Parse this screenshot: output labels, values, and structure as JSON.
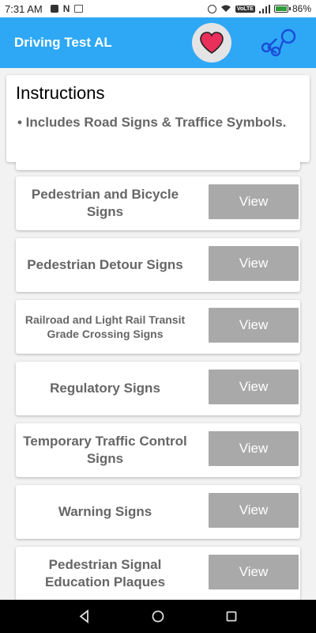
{
  "status_bar": {
    "time": "7:31 AM",
    "volte": "VoLTE",
    "battery_percent": "86%",
    "battery_level": 0.86
  },
  "app_bar": {
    "title": "Driving Test AL",
    "accent_color": "#2ea8f5",
    "favorite_icon": "heart-icon",
    "share_icon": "share-icon"
  },
  "instructions": {
    "title": "Instructions",
    "bullet": "• Includes Road Signs & Traffice Symbols."
  },
  "sign_categories": [
    {
      "label": "Pedestrian and Bicycle Signs",
      "button": "View"
    },
    {
      "label": "Pedestrian Detour Signs",
      "button": "View"
    },
    {
      "label": "Railroad and Light Rail Transit Grade Crossing Signs",
      "button": "View"
    },
    {
      "label": "Regulatory Signs",
      "button": "View"
    },
    {
      "label": "Temporary Traffic Control Signs",
      "button": "View"
    },
    {
      "label": "Warning Signs",
      "button": "View"
    },
    {
      "label": "Pedestrian Signal Education Plaques",
      "button": "View"
    }
  ]
}
